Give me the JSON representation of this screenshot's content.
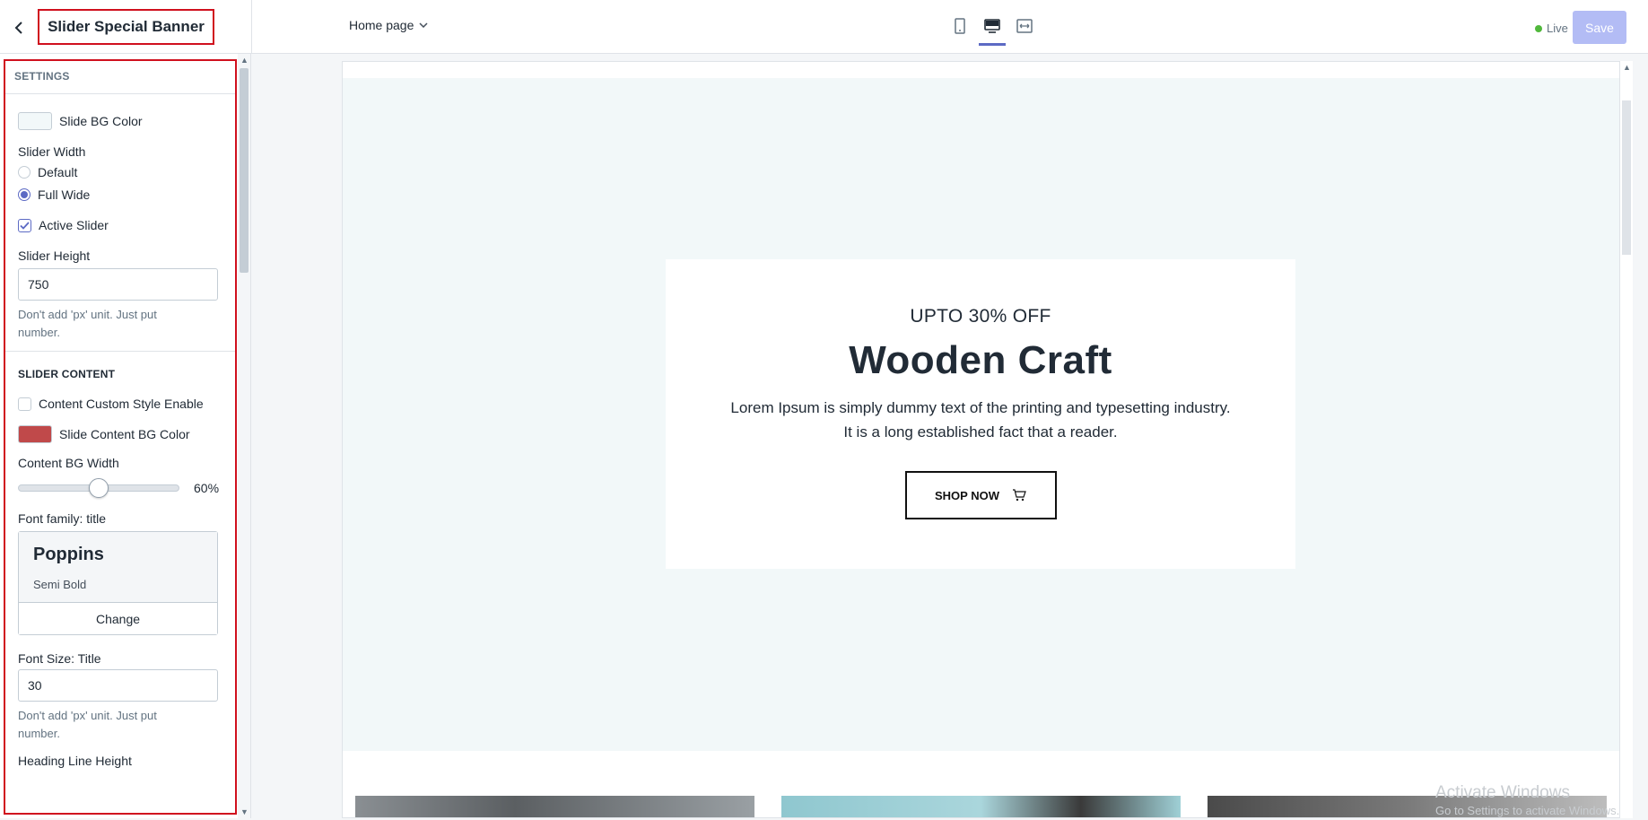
{
  "header": {
    "title": "Slider Special Banner",
    "page_select": "Home page",
    "live_label": "Live",
    "save_label": "Save",
    "view_icons": [
      "mobile-view-icon",
      "desktop-view-icon",
      "fullscreen-view-icon"
    ],
    "active_view": "desktop-view-icon"
  },
  "sidebar": {
    "settings_heading": "SETTINGS",
    "slide_bg_color_label": "Slide BG Color",
    "slide_bg_color": "#f2f8f9",
    "slider_width_label": "Slider Width",
    "width_options": [
      "Default",
      "Full Wide"
    ],
    "width_selected": "Full Wide",
    "active_slider_label": "Active Slider",
    "active_slider_checked": true,
    "slider_height_label": "Slider Height",
    "slider_height_value": "750",
    "slider_height_help": "Don't add 'px' unit. Just put number.",
    "slider_content_heading": "SLIDER CONTENT",
    "content_custom_style_label": "Content Custom Style Enable",
    "content_custom_style_checked": false,
    "slide_content_bg_color_label": "Slide Content BG Color",
    "slide_content_bg_color": "#c0494a",
    "content_bg_width_label": "Content BG Width",
    "content_bg_width_value": "60%",
    "content_bg_width_fraction": 0.5,
    "font_family_label": "Font family: title",
    "font_family_name": "Poppins",
    "font_family_weight": "Semi Bold",
    "font_change_label": "Change",
    "font_size_title_label": "Font Size: Title",
    "font_size_title_value": "30",
    "font_size_help": "Don't add 'px' unit. Just put number.",
    "heading_line_height_label": "Heading Line Height"
  },
  "preview": {
    "subtitle": "UPTO 30% OFF",
    "heading": "Wooden Craft",
    "description": "Lorem Ipsum is simply dummy text of the printing and typesetting industry. It is a long established fact that a reader.",
    "button_label": "SHOP NOW"
  },
  "watermark": {
    "line1": "Activate Windows",
    "line2": "Go to Settings to activate Windows."
  },
  "colors": {
    "accent": "#5c6ac4",
    "highlight_border": "#d0101e",
    "save_disabled": "#b3bcf5",
    "live_dot": "#50b83c"
  }
}
